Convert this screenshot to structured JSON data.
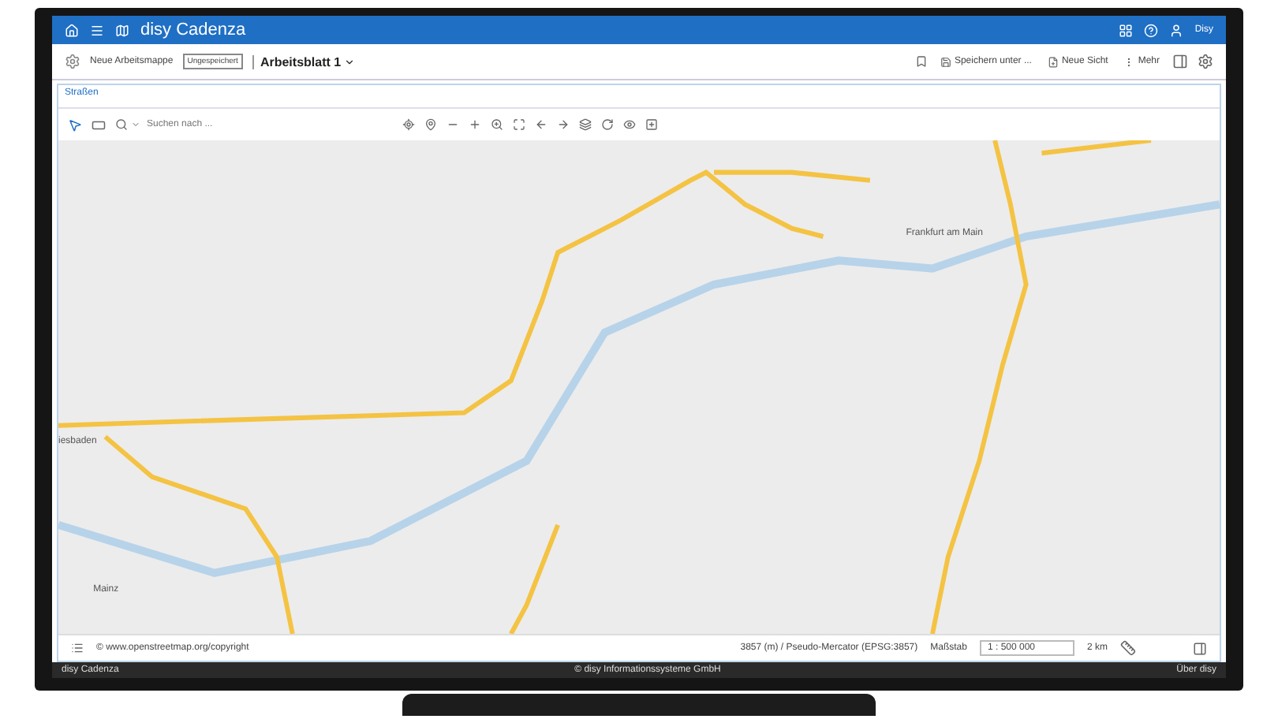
{
  "app_bar": {
    "title": "disy Cadenza",
    "user": "Disy"
  },
  "workbook_bar": {
    "workbook": "Neue Arbeitsmappe",
    "badge": "Ungespeichert",
    "sheet": "Arbeitsblatt 1",
    "actions": [
      {
        "label": "Speichern unter ..."
      },
      {
        "label": "Neue Sicht"
      },
      {
        "label": "Mehr"
      }
    ]
  },
  "panel": {
    "title": "Straßen"
  },
  "map_toolbar": {
    "search": {
      "placeholder": "Suchen nach ..."
    }
  },
  "map": {
    "labels": [
      {
        "text": "Frankfurt am Main"
      },
      {
        "text": "iesbaden"
      },
      {
        "text": "Mainz"
      }
    ]
  },
  "status_bar": {
    "attribution": "© www.openstreetmap.org/copyright",
    "projection": "3857 (m) / Pseudo-Mercator (EPSG:3857)",
    "scale_label": "Maßstab",
    "scale_value": "1 : 500 000",
    "distance": "2 km"
  },
  "footer": {
    "left": "disy Cadenza",
    "center": "© disy Informationssysteme GmbH",
    "right": "Über disy"
  }
}
